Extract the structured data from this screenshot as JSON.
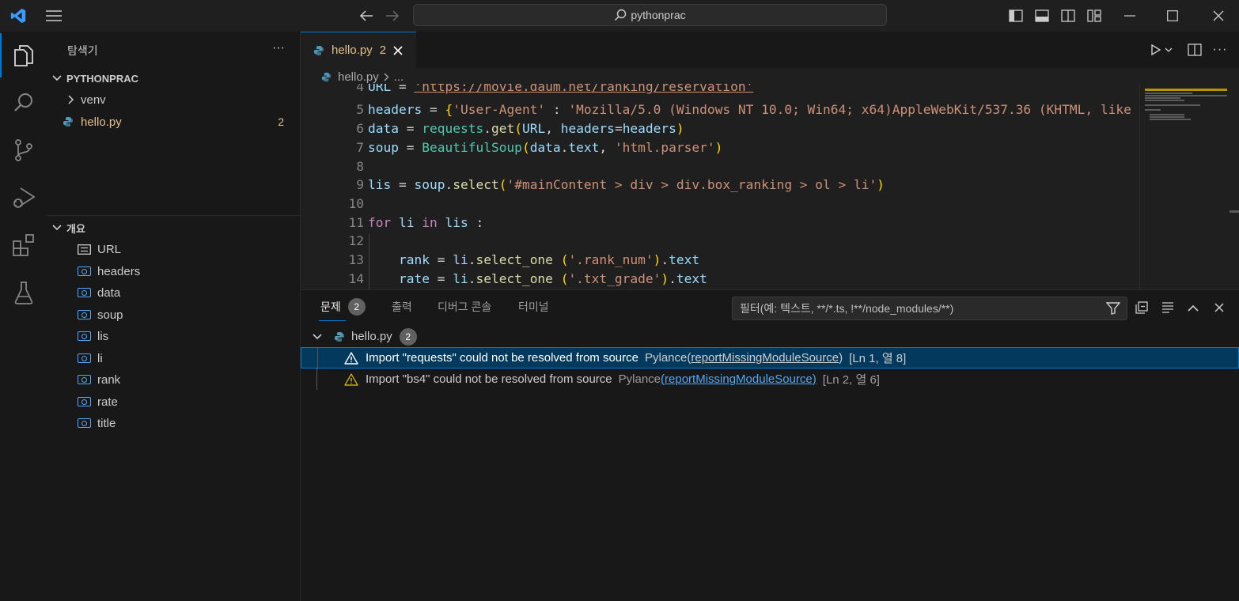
{
  "titlebar": {
    "search_text": "pythonprac"
  },
  "sidebar": {
    "explorer_title": "탐색기",
    "more_label": "···",
    "project_name": "PYTHONPRAC",
    "tree": [
      {
        "label": "venv",
        "type": "folder"
      },
      {
        "label": "hello.py",
        "type": "file",
        "badge": "2"
      }
    ],
    "outline_title": "개요",
    "outline": [
      "URL",
      "headers",
      "data",
      "soup",
      "lis",
      "li",
      "rank",
      "rate",
      "title"
    ]
  },
  "editor": {
    "tab_label": "hello.py",
    "tab_badge": "2",
    "breadcrumb_file": "hello.py",
    "breadcrumb_more": "...",
    "lines": [
      {
        "n": "4",
        "text": "URL = 'https://movie.daum.net/ranking/reservation'"
      },
      {
        "n": "5",
        "text": "headers = {'User-Agent' : 'Mozilla/5.0 (Windows NT 10.0; Win64; x64)AppleWebKit/537.36 (KHTML, like Ge"
      },
      {
        "n": "6",
        "text": "data = requests.get(URL, headers=headers)"
      },
      {
        "n": "7",
        "text": "soup = BeautifulSoup(data.text, 'html.parser')"
      },
      {
        "n": "8",
        "text": ""
      },
      {
        "n": "9",
        "text": "lis = soup.select('#mainContent > div > div.box_ranking > ol > li')"
      },
      {
        "n": "10",
        "text": ""
      },
      {
        "n": "11",
        "text": "for li in lis :"
      },
      {
        "n": "12",
        "text": ""
      },
      {
        "n": "13",
        "text": "    rank = li.select_one ('.rank_num').text"
      },
      {
        "n": "14",
        "text": "    rate = li.select_one ('.txt_grade').text"
      }
    ]
  },
  "panel": {
    "tabs": [
      {
        "label": "문제",
        "badge": "2",
        "active": true
      },
      {
        "label": "출력"
      },
      {
        "label": "디버그 콘솔"
      },
      {
        "label": "터미널"
      }
    ],
    "filter_placeholder": "필터(예: 텍스트, **/*.ts, !**/node_modules/**)",
    "problem_file": "hello.py",
    "problem_count": "2",
    "problems": [
      {
        "message": "Import \"requests\" could not be resolved from source",
        "source": "Pylance",
        "code": "reportMissingModuleSource",
        "location": "[Ln 1, 열 8]"
      },
      {
        "message": "Import \"bs4\" could not be resolved from source",
        "source": "Pylance",
        "code": "reportMissingModuleSource",
        "location": "[Ln 2, 열 6]"
      }
    ]
  },
  "colors": {
    "accent": "#0078d4",
    "modified_file": "#e2c08d",
    "warning": "#cca700",
    "link": "#4daafc"
  }
}
